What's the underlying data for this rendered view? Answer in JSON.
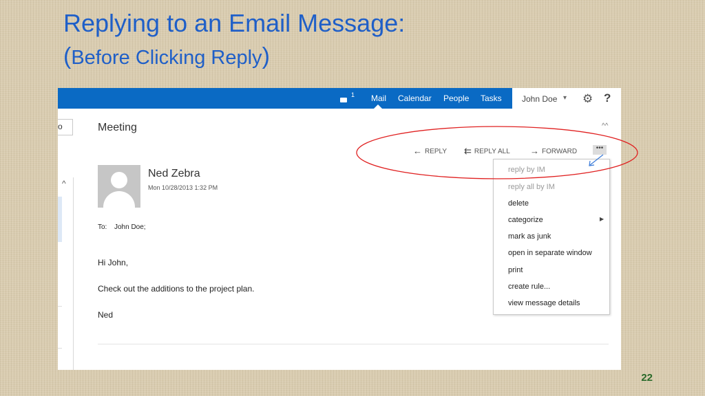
{
  "slide": {
    "title": "Replying to an Email Message:",
    "subtitle_open": "(",
    "subtitle_text": "Before Clicking Reply",
    "subtitle_close": ")",
    "page_number": "22"
  },
  "topbar": {
    "chat_count": "1",
    "nav": [
      "Mail",
      "Calendar",
      "People",
      "Tasks"
    ],
    "user_name": "John Doe",
    "user_caret": "▾",
    "gear": "⚙",
    "help": "?"
  },
  "left_pane": {
    "search_fragment": "o",
    "scroll_up": "^"
  },
  "email": {
    "subject": "Meeting",
    "collapse": "^^",
    "sender": "Ned Zebra",
    "date": "Mon 10/28/2013 1:32 PM",
    "to_label": "To:",
    "to_value": "John Doe;",
    "body": [
      "Hi John,",
      "Check out the additions to the project plan.",
      "Ned"
    ]
  },
  "actions": {
    "reply": "REPLY",
    "reply_all": "REPLY ALL",
    "forward": "FORWARD",
    "more": "•••"
  },
  "menu": {
    "items": [
      "reply by IM",
      "reply all by IM",
      "delete",
      "categorize",
      "mark as junk",
      "open in separate window",
      "print",
      "create rule...",
      "view message details"
    ],
    "submenu_arrow": "▶"
  },
  "colors": {
    "topbar": "#0a6ac4",
    "title": "#1f5fc8",
    "annotation": "#e02020",
    "pointer": "#3a7ad8"
  }
}
